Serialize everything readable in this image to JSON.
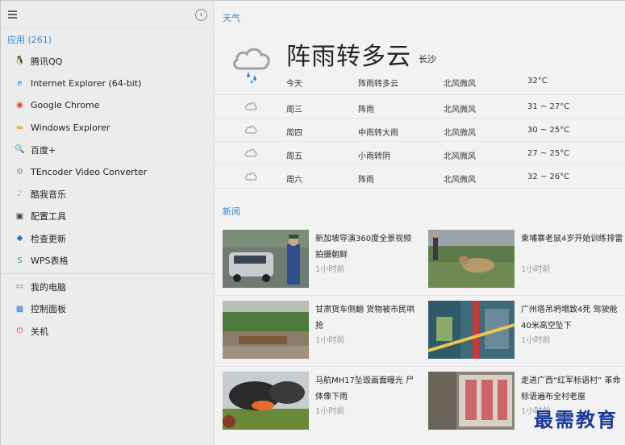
{
  "sidebar": {
    "apps_header": "应用 (261)",
    "apps": [
      {
        "label": "腾讯QQ",
        "icon": "qq-penguin-icon",
        "color": "#222222",
        "glyph": "🐧"
      },
      {
        "label": "Internet Explorer (64-bit)",
        "icon": "internet-explorer-icon",
        "color": "#1e7fd0",
        "glyph": "e"
      },
      {
        "label": "Google Chrome",
        "icon": "chrome-icon",
        "color": "#d44a3a",
        "glyph": "◉"
      },
      {
        "label": "Windows Explorer",
        "icon": "folder-icon",
        "color": "#e8b84a",
        "glyph": "▬"
      },
      {
        "label": "百度+",
        "icon": "baidu-search-icon",
        "color": "#2e7be0",
        "glyph": "🔍"
      },
      {
        "label": "TEncoder Video Converter",
        "icon": "tencoder-icon",
        "color": "#888888",
        "glyph": "⚙"
      },
      {
        "label": "酷我音乐",
        "icon": "kuwo-music-icon",
        "color": "#f0a020",
        "glyph": "♪"
      },
      {
        "label": "配置工具",
        "icon": "config-tool-icon",
        "color": "#444444",
        "glyph": "▣"
      },
      {
        "label": "检查更新",
        "icon": "update-icon",
        "color": "#2d6ec8",
        "glyph": "◆"
      },
      {
        "label": "WPS表格",
        "icon": "wps-sheet-icon",
        "color": "#2ea24a",
        "glyph": "S"
      }
    ],
    "system": [
      {
        "label": "我的电脑",
        "icon": "computer-icon",
        "color": "#3b7bd0",
        "glyph": "▭"
      },
      {
        "label": "控制面板",
        "icon": "control-panel-icon",
        "color": "#3b7bd0",
        "glyph": "▦"
      },
      {
        "label": "关机",
        "icon": "power-icon",
        "color": "#e03030",
        "glyph": "⏻"
      }
    ]
  },
  "weather": {
    "section_title": "天气",
    "condition": "阵雨转多云",
    "city": "长沙",
    "today": {
      "day": "今天",
      "desc": "阵雨转多云",
      "wind": "北风微风",
      "temp": "32°C"
    },
    "forecast": [
      {
        "day": "周三",
        "desc": "阵雨",
        "wind": "北风微风",
        "temp": "31 ~ 27°C"
      },
      {
        "day": "周四",
        "desc": "中雨转大雨",
        "wind": "北风微风",
        "temp": "30 ~ 25°C"
      },
      {
        "day": "周五",
        "desc": "小雨转阴",
        "wind": "北风微风",
        "temp": "27 ~ 25°C"
      },
      {
        "day": "周六",
        "desc": "阵雨",
        "wind": "北风微风",
        "temp": "32 ~ 26°C"
      }
    ]
  },
  "news": {
    "section_title": "新闻",
    "items": [
      {
        "title": "新加坡导演360度全景视频拍摄朝鲜",
        "time": "1小时前"
      },
      {
        "title": "柬埔寨老鼠4岁开始训练排雷",
        "time": "1小时前"
      },
      {
        "title": "甘肃货车侧翻 货物被市民哄抢",
        "time": "1小时前"
      },
      {
        "title": "广州塔吊坍塌致4死 驾驶舱40米高空坠下",
        "time": "1小时前"
      },
      {
        "title": "马航MH17坠毁画面曝光 尸体像下雨",
        "time": "1小时前"
      },
      {
        "title": "走进广西“红军标语村” 革命标语遍布全村老屋",
        "time": "1小时前"
      }
    ]
  },
  "watermark": "最需教育"
}
